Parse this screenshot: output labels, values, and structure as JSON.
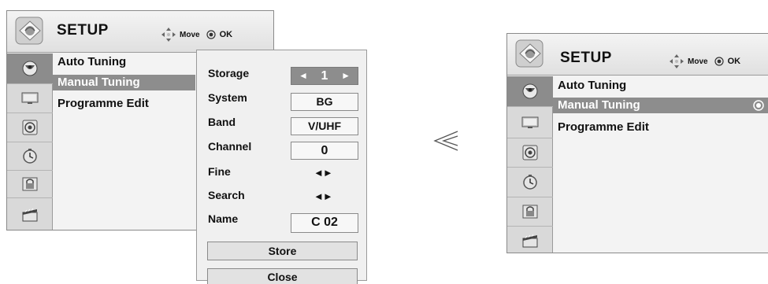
{
  "left_menu": {
    "title": "SETUP",
    "hint": {
      "move": "Move",
      "ok": "OK"
    },
    "categories": [
      {
        "icon": "satellite-dish-icon",
        "active": true
      },
      {
        "icon": "monitor-icon",
        "active": false
      },
      {
        "icon": "speaker-icon",
        "active": false
      },
      {
        "icon": "clock-icon",
        "active": false
      },
      {
        "icon": "lock-icon",
        "active": false
      },
      {
        "icon": "clapperboard-icon",
        "active": false
      }
    ],
    "items": [
      "Auto Tuning",
      "Manual Tuning",
      "Programme Edit"
    ],
    "selected_index": 1
  },
  "submenu": {
    "rows": {
      "storage": {
        "label": "Storage",
        "value": "1"
      },
      "system": {
        "label": "System",
        "value": "BG"
      },
      "band": {
        "label": "Band",
        "value": "V/UHF"
      },
      "channel": {
        "label": "Channel",
        "value": "0"
      },
      "fine": {
        "label": "Fine",
        "value": "◄►"
      },
      "search": {
        "label": "Search",
        "value": "◄►"
      },
      "name": {
        "label": "Name",
        "value": "C 02"
      }
    },
    "store_label": "Store",
    "close_label": "Close"
  },
  "separator": "≪",
  "right_menu": {
    "title": "SETUP",
    "hint": {
      "move": "Move",
      "ok": "OK"
    },
    "items": [
      "Auto Tuning",
      "Manual Tuning",
      "Programme Edit"
    ],
    "selected_index": 1
  },
  "colors": {
    "highlight": "#8d8d8d",
    "panel": "#f3f3f3",
    "icon_column": "#d9d9d9"
  }
}
